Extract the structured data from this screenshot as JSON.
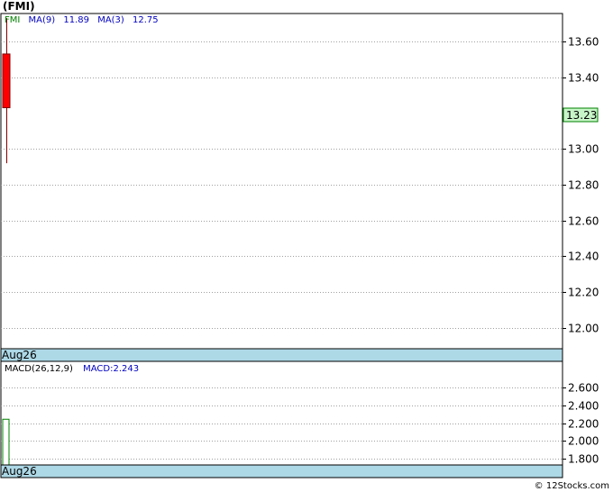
{
  "title": "(FMI)",
  "footer": "© 12Stocks.com",
  "price_panel": {
    "legend": {
      "symbol": "FMI",
      "ma9_label": "MA(9)",
      "ma9_value": "11.89",
      "ma3_label": "MA(3)",
      "ma3_value": "12.75"
    },
    "date_label": "Aug26",
    "current_price": "13.23",
    "y_ticks": [
      "13.60",
      "13.40",
      "13.00",
      "12.80",
      "12.60",
      "12.40",
      "12.20",
      "12.00"
    ]
  },
  "macd_panel": {
    "legend": {
      "label": "MACD(26,12,9)",
      "value_label": "MACD:2.243"
    },
    "date_label": "Aug26",
    "y_ticks": [
      "2.600",
      "2.400",
      "2.200",
      "2.000",
      "1.800"
    ]
  },
  "colors": {
    "candle_body": "#ff0000",
    "candle_wick": "#800000",
    "date_band": "#add8e6",
    "price_badge": "#c8f5c8",
    "legend_symbol": "#008000",
    "legend_ma": "#0000c0",
    "macd_bar": "#008000"
  },
  "chart_data": [
    {
      "type": "candlestick",
      "title": "(FMI)",
      "x": [
        "Aug26"
      ],
      "series": [
        {
          "name": "FMI",
          "open": 13.53,
          "high": 13.73,
          "low": 12.92,
          "close": 13.23
        }
      ],
      "overlays": [
        {
          "name": "MA(9)",
          "value": 11.89
        },
        {
          "name": "MA(3)",
          "value": 12.75
        }
      ],
      "y_ticks": [
        12.0,
        12.2,
        12.4,
        12.6,
        12.8,
        13.0,
        13.4,
        13.6
      ],
      "last_price": 13.23,
      "grid": true
    },
    {
      "type": "bar",
      "title": "MACD(26,12,9)",
      "x": [
        "Aug26"
      ],
      "series": [
        {
          "name": "MACD",
          "values": [
            2.243
          ]
        }
      ],
      "y_ticks": [
        1.8,
        2.0,
        2.2,
        2.4,
        2.6
      ],
      "grid": true
    }
  ]
}
